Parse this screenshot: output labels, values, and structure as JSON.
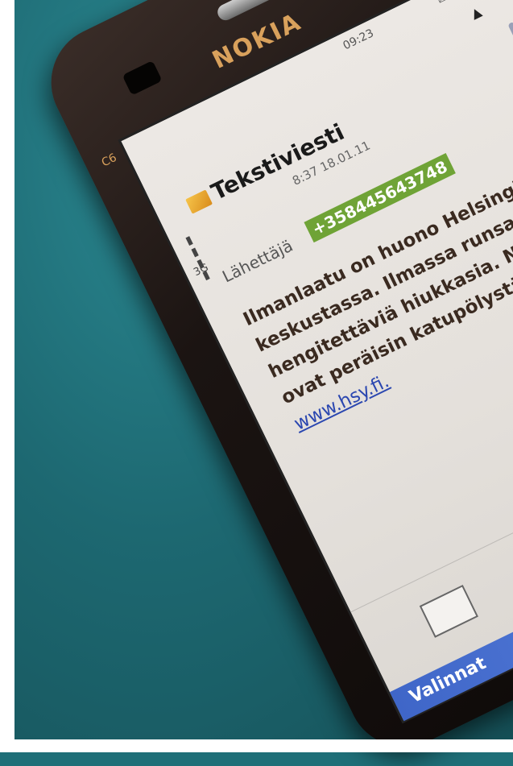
{
  "phone": {
    "brand": "NOKIA",
    "model": "C6",
    "status_bar": {
      "time": "09:23",
      "network": "3G"
    },
    "message": {
      "title": "Tekstiviesti",
      "datetime": "8:37 18.01.11",
      "sender_label": "Lähettäjä",
      "sender_number": "+358445643748",
      "body_text": "Ilmanlaatu on huono Helsingin keskustassa. Ilmassa runsaasti hengitettäviä hiukkasia. Ne ovat peräisin katupölystä. -",
      "link_text": "www.hsy.fi."
    },
    "softkey_label": "Valinnat"
  },
  "colors": {
    "background_teal": "#1f6f78",
    "sender_highlight": "#6fa336",
    "softkey_blue": "#4a72d3",
    "logo_gold": "#d9a15c"
  }
}
